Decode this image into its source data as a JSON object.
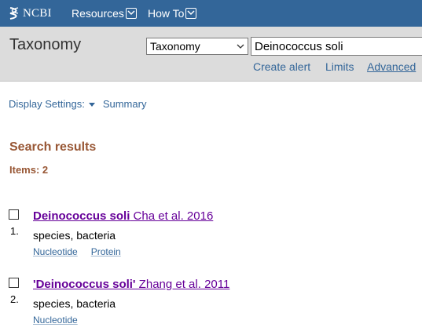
{
  "header": {
    "logo_text": "NCBI",
    "menus": [
      "Resources",
      "How To"
    ]
  },
  "search": {
    "db_title": "Taxonomy",
    "db_select_value": "Taxonomy",
    "query": "Deinococcus soli",
    "links": [
      "Create alert",
      "Limits",
      "Advanced"
    ]
  },
  "display": {
    "settings_label": "Display Settings:",
    "summary_label": "Summary"
  },
  "results": {
    "title": "Search results",
    "items_label": "Items: 2",
    "list": [
      {
        "num": "1.",
        "title_bold": "Deinococcus soli",
        "title_rest": " Cha et al. 2016",
        "desc": "species, bacteria",
        "links": [
          "Nucleotide",
          "Protein"
        ]
      },
      {
        "num": "2.",
        "title_bold": "'Deinococcus soli'",
        "title_rest": " Zhang et al. 2011",
        "desc": "species, bacteria",
        "links": [
          "Nucleotide"
        ]
      }
    ]
  },
  "colors": {
    "topbar": "#336699",
    "searchbar": "#dcdcdc",
    "link": "#336699",
    "visited_title": "#660099",
    "results_heading": "#985735"
  }
}
